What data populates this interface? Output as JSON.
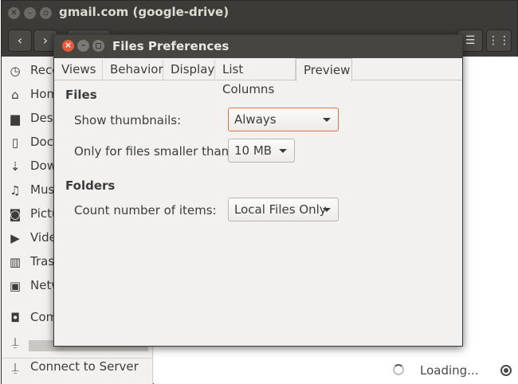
{
  "background_window": {
    "title": "gmail.com (google-drive)",
    "sidebar": {
      "items": [
        {
          "label": "Recent",
          "icon": "clock-icon"
        },
        {
          "label": "Home",
          "icon": "home-icon"
        },
        {
          "label": "Desktop",
          "icon": "folder-icon"
        },
        {
          "label": "Documents",
          "icon": "document-icon"
        },
        {
          "label": "Downloads",
          "icon": "download-icon"
        },
        {
          "label": "Music",
          "icon": "music-icon"
        },
        {
          "label": "Pictures",
          "icon": "camera-icon"
        },
        {
          "label": "Videos",
          "icon": "video-icon"
        },
        {
          "label": "Trash",
          "icon": "trash-icon"
        },
        {
          "label": "Network",
          "icon": "network-icon"
        },
        {
          "label": "Computer",
          "icon": "drive-icon"
        },
        {
          "label": "",
          "icon": "network-drive-icon"
        },
        {
          "label": "Connect to Server",
          "icon": "server-icon"
        }
      ]
    },
    "status": {
      "loading_text": "Loading..."
    }
  },
  "dialog": {
    "title": "Files Preferences",
    "tabs": [
      {
        "label": "Views",
        "active": false
      },
      {
        "label": "Behavior",
        "active": false
      },
      {
        "label": "Display",
        "active": false
      },
      {
        "label": "List Columns",
        "active": false
      },
      {
        "label": "Preview",
        "active": true
      }
    ],
    "files_section": {
      "heading": "Files",
      "show_thumbnails_label": "Show thumbnails:",
      "show_thumbnails_value": "Always",
      "smaller_than_label": "Only for files smaller than:",
      "smaller_than_value": "10 MB"
    },
    "folders_section": {
      "heading": "Folders",
      "count_items_label": "Count number of items:",
      "count_items_value": "Local Files Only"
    }
  },
  "colors": {
    "titlebar": "#3c3b37",
    "close_button": "#e35b3a",
    "focus_border": "#e0704c",
    "window_bg": "#f2f1f0"
  }
}
